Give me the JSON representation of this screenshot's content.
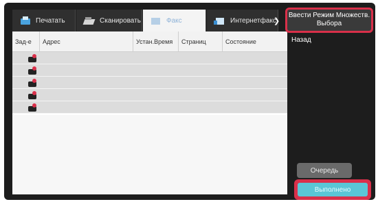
{
  "tabs": [
    {
      "label": "Печатать",
      "icon": "printer-icon"
    },
    {
      "label": "Сканировать",
      "icon": "scanner-icon"
    },
    {
      "label": "Факс",
      "icon": "fax-icon"
    },
    {
      "label": "Интернетфакс",
      "icon": "internet-fax-icon"
    }
  ],
  "tab_scroll_icon": "chevron-right-icon",
  "table": {
    "headers": [
      "Зад-е",
      "Адрес",
      "Устан.Время",
      "Страниц",
      "Состояние"
    ],
    "rows": [
      {
        "icon": "fax-job-icon"
      },
      {
        "icon": "fax-job-icon"
      },
      {
        "icon": "fax-job-icon"
      },
      {
        "icon": "fax-job-icon"
      },
      {
        "icon": "fax-job-icon"
      }
    ]
  },
  "panel": {
    "multi_select_label": "Ввести Режим Множеств. Выбора",
    "back_label": "Назад",
    "queue_label": "Очередь",
    "done_label": "Выполнено"
  },
  "colors": {
    "highlight": "#d9304a",
    "done_button": "#5ac6d6",
    "active_tab_text": "#8fb3d8"
  }
}
